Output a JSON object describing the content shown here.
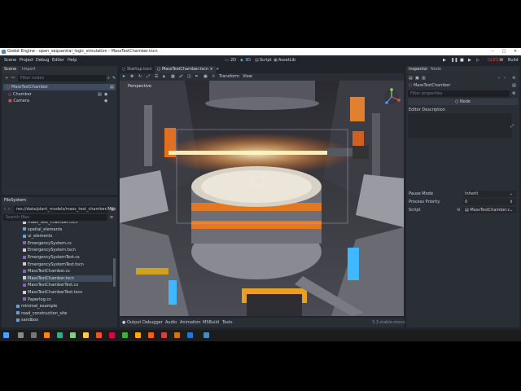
{
  "window": {
    "title": "Godot Engine - open_sequential_logic_simulation - MassTestChamber.tscn"
  },
  "menu": {
    "items": [
      "Scene",
      "Project",
      "Debug",
      "Editor",
      "Help"
    ]
  },
  "workspace": {
    "items": [
      "2D",
      "3D",
      "Script",
      "AssetLib"
    ],
    "active": "3D"
  },
  "toolbar": {
    "renderer": "GLES3",
    "build_label": "Build"
  },
  "scene_panel": {
    "tabs": [
      "Scene",
      "Import"
    ],
    "filter_placeholder": "Filter nodes",
    "nodes": [
      {
        "label": "MassTestChamber"
      },
      {
        "label": "Chamber"
      },
      {
        "label": "Camera"
      }
    ]
  },
  "filesystem": {
    "title": "FileSystem",
    "path": "res://data/plant_models/mass_test_chamber/Mas",
    "search_placeholder": "Search files",
    "items": [
      "mass_test_chamber.tscn",
      "spatial_elements",
      "ui_elements",
      "EmergencySystem.cs",
      "EmergencySystem.tscn",
      "EmergencySystemTest.cs",
      "EmergencySystemTest.tscn",
      "MassTestChamber.cs",
      "MassTestChamber.tscn",
      "MassTestChamberTest.cs",
      "MassTestChamberTest.tscn",
      "Paperlog.cs",
      "minimal_example",
      "road_construction_site",
      "sandbox"
    ],
    "selected": "MassTestChamber.tscn"
  },
  "editor_tabs": {
    "items": [
      "Startup.tscn",
      "MassTestChamber.tscn"
    ],
    "active": "MassTestChamber.tscn"
  },
  "viewport": {
    "menu_transform": "Transform",
    "menu_view": "View",
    "perspective_label": "Perspective"
  },
  "bottom_panel": {
    "items": [
      "Output",
      "Debugger",
      "Audio",
      "Animation",
      "MSBuild",
      "Tests"
    ],
    "version": "3.3.stable.mono"
  },
  "inspector": {
    "tabs": [
      "Inspector",
      "Node"
    ],
    "node_name": "MassTestChamber",
    "filter_placeholder": "Filter properties",
    "node_type": "Node",
    "section_editor_description": "Editor Description",
    "properties": [
      {
        "label": "Pause Mode",
        "value": "Inherit"
      },
      {
        "label": "Process Priority",
        "value": "0"
      },
      {
        "label": "Script",
        "value": "MassTestChamber.c"
      }
    ]
  },
  "colors": {
    "accent": "#478cbf",
    "editor_bg": "#21252b",
    "panel_bg": "#2a2e35",
    "selection": "#3d4b5c",
    "play_highlight": "#e04040"
  }
}
